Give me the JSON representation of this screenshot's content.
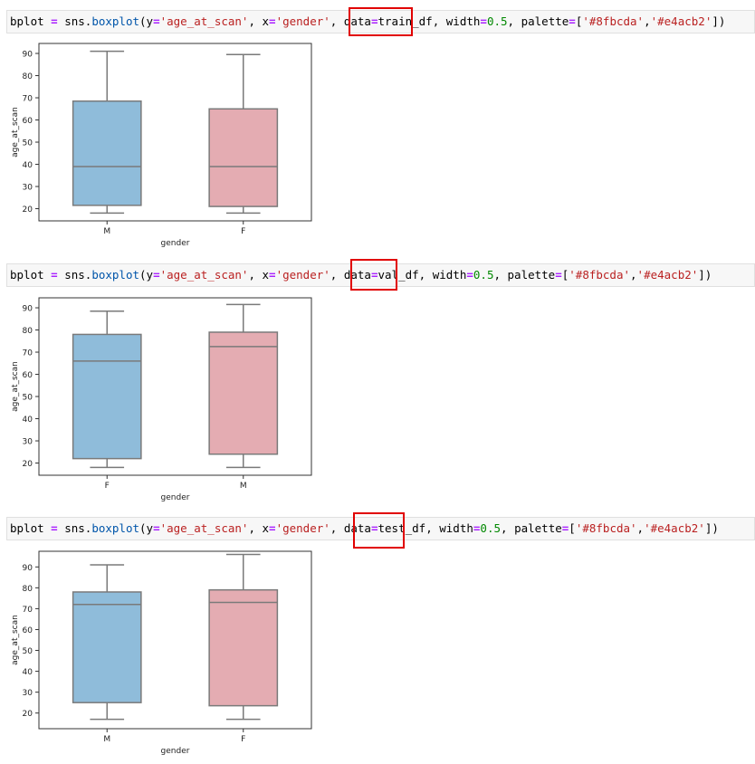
{
  "cells": [
    {
      "code": {
        "var": "bplot",
        "eq": " = ",
        "mod": "sns",
        "dot": ".",
        "fn": "boxplot",
        "open": "(",
        "y_key": "y",
        "y_val": "'age_at_scan'",
        "sep1": ", ",
        "x_key": "x",
        "x_val": "'gender'",
        "sep2": ", ",
        "data_key": "data",
        "data_val": "train_df",
        "sep3": ", ",
        "width_key": "width",
        "width_val": "0.5",
        "sep4": ", ",
        "pal_key": "palette",
        "pal_open": "[",
        "pal1": "'#8fbcda'",
        "pal_sep": ",",
        "pal2": "'#e4acb2'",
        "close": "])"
      }
    },
    {
      "code": {
        "var": "bplot",
        "eq": " = ",
        "mod": "sns",
        "dot": ".",
        "fn": "boxplot",
        "open": "(",
        "y_key": "y",
        "y_val": "'age_at_scan'",
        "sep1": ", ",
        "x_key": "x",
        "x_val": "'gender'",
        "sep2": ", ",
        "data_key": "data",
        "data_val": "val_df",
        "sep3": ", ",
        "width_key": "width",
        "width_val": "0.5",
        "sep4": ", ",
        "pal_key": "palette",
        "pal_open": "[",
        "pal1": "'#8fbcda'",
        "pal_sep": ",",
        "pal2": "'#e4acb2'",
        "close": "])"
      }
    },
    {
      "code": {
        "var": "bplot",
        "eq": " = ",
        "mod": "sns",
        "dot": ".",
        "fn": "boxplot",
        "open": "(",
        "y_key": "y",
        "y_val": "'age_at_scan'",
        "sep1": ", ",
        "x_key": "x",
        "x_val": "'gender'",
        "sep2": ", ",
        "data_key": "data",
        "data_val": "test_df",
        "sep3": ", ",
        "width_key": "width",
        "width_val": "0.5",
        "sep4": ", ",
        "pal_key": "palette",
        "pal_open": "[",
        "pal1": "'#8fbcda'",
        "pal_sep": ",",
        "pal2": "'#e4acb2'",
        "close": "])"
      }
    }
  ],
  "chart_data": [
    {
      "type": "box",
      "xlabel": "gender",
      "ylabel": "age_at_scan",
      "ylim": [
        14.5,
        94.5
      ],
      "yticks": [
        20,
        30,
        40,
        50,
        60,
        70,
        80,
        90
      ],
      "colors": [
        "#8fbcda",
        "#e4acb2"
      ],
      "edge_color": "#7a7a7a",
      "categories": [
        "M",
        "F"
      ],
      "boxes": [
        {
          "min": 18,
          "q1": 21.5,
          "median": 39,
          "q3": 68.5,
          "max": 91
        },
        {
          "min": 18,
          "q1": 21,
          "median": 39,
          "q3": 65,
          "max": 89.5
        }
      ]
    },
    {
      "type": "box",
      "xlabel": "gender",
      "ylabel": "age_at_scan",
      "ylim": [
        14.5,
        94.5
      ],
      "yticks": [
        20,
        30,
        40,
        50,
        60,
        70,
        80,
        90
      ],
      "colors": [
        "#8fbcda",
        "#e4acb2"
      ],
      "edge_color": "#7a7a7a",
      "categories": [
        "F",
        "M"
      ],
      "boxes": [
        {
          "min": 18,
          "q1": 22,
          "median": 66,
          "q3": 78,
          "max": 88.5
        },
        {
          "min": 18,
          "q1": 24,
          "median": 72.5,
          "q3": 79,
          "max": 91.5
        }
      ]
    },
    {
      "type": "box",
      "xlabel": "gender",
      "ylabel": "age_at_scan",
      "ylim": [
        12.5,
        97.5
      ],
      "yticks": [
        20,
        30,
        40,
        50,
        60,
        70,
        80,
        90
      ],
      "colors": [
        "#8fbcda",
        "#e4acb2"
      ],
      "edge_color": "#7a7a7a",
      "categories": [
        "M",
        "F"
      ],
      "boxes": [
        {
          "min": 17,
          "q1": 25,
          "median": 72,
          "q3": 78,
          "max": 91
        },
        {
          "min": 17,
          "q1": 23.5,
          "median": 73,
          "q3": 79,
          "max": 96
        }
      ]
    }
  ]
}
